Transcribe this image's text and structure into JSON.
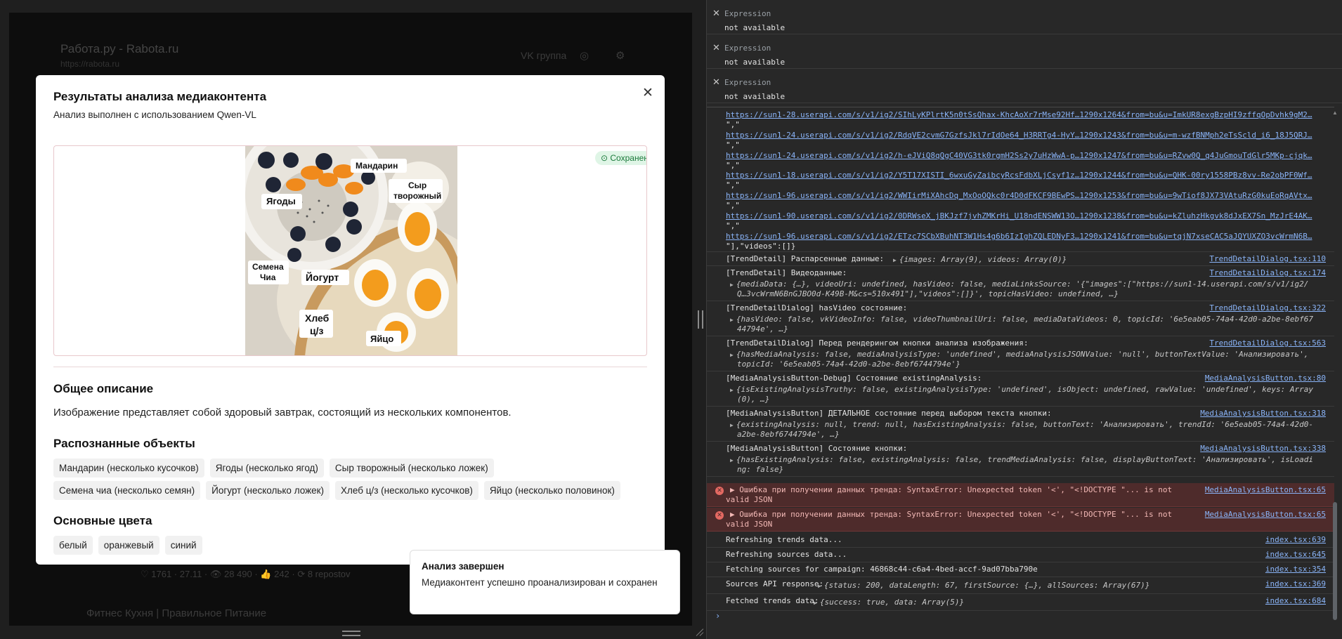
{
  "background": {
    "title": "Работа.ру - Rabota.ru",
    "subtitle": "https://rabota.ru",
    "vk_label": "VK группа",
    "stats": "♡ 1761 · 27.11 · 👁 28 490 · 👍 242 · ⟳ 8 repostov",
    "card_title": "Фитнес Кухня | Правильное Питание"
  },
  "modal": {
    "title": "Результаты анализа медиаконтента",
    "subtitle": "Анализ выполнен с использованием Qwen-VL",
    "saved_badge": "Сохранено",
    "image_labels": [
      "Мандарин",
      "Сыр творожный",
      "Ягоды",
      "Семена Чиа",
      "Йогурт",
      "Хлеб ц/з",
      "Яйцо"
    ],
    "description_title": "Общее описание",
    "description": "Изображение представляет собой здоровый завтрак, состоящий из нескольких компонентов.",
    "objects_title": "Распознанные объекты",
    "objects_row1": [
      "Мандарин (несколько кусочков)",
      "Ягоды (несколько ягод)",
      "Сыр творожный (несколько ложек)"
    ],
    "objects_row2": [
      "Семена чиа (несколько семян)",
      "Йогурт (несколько ложек)",
      "Хлеб ц/з (несколько кусочков)",
      "Яйцо (несколько половинок)"
    ],
    "colors_title": "Основные цвета",
    "colors": [
      "белый",
      "оранжевый",
      "синий"
    ]
  },
  "toast": {
    "title": "Анализ завершен",
    "body": "Медиаконтент успешно проанализирован и сохранен"
  },
  "devtools": {
    "watch": [
      {
        "label": "Expression",
        "value": "not available"
      },
      {
        "label": "Expression",
        "value": "not available"
      },
      {
        "label": "Expression",
        "value": "not available"
      }
    ],
    "url_lines": [
      "https://sun1-28.userapi.com/s/v1/ig2/SIhLyKPlrtK5n0tSsQhax-KhcAoXr7rMse92Hf…1290x1264&from=bu&u=ImkUR8exgBzpHI9zffqOpDvhk9gM2…",
      "https://sun1-24.userapi.com/s/v1/ig2/RdqVE2cvmG7GzfsJkl7rIdOe64_H3RRTg4-HyY…1290x1243&from=bu&u=m-wzfBNMph2eTsScld_i6_18J5QRJ…",
      "https://sun1-24.userapi.com/s/v1/ig2/h-eJViQ8qQgC40VG3tk0rgmH2Ss2y7uHzWwA-p…1290x1247&from=bu&u=RZvw0Q_q4JuGmouTdGlr5MKp-cjqk…",
      "https://sun1-18.userapi.com/s/v1/ig2/Y5T17XISTI_6wxuGyZaibcyRcsFdbXLjCsyf1z…1290x1244&from=bu&u=QHK-00ry1558PBz8vv-Re2obPF0Wf…",
      "https://sun1-96.userapi.com/s/v1/ig2/WWIirMiXAhcDq_MxOoOQkc0r4D0dFKCF9BEwPS…1290x1253&from=bu&u=9wTiof8JX73VAtuRzG0kuEoRqAVtx…",
      "https://sun1-90.userapi.com/s/v1/ig2/0DRWseX_jBKJzf7jvhZMKrHi_U18ndENSWW13O…1290x1238&from=bu&u=kZluhzHkgvk8dJxEX7Sn_MzJrE4AK…",
      "https://sun1-96.userapi.com/s/v1/ig2/ETzc7SCbXBuhNT3W1Hs4g6b6IzIghZQLEDNyF3…1290x1241&from=bu&u=tqjN7xseCAC5aJQYUXZO3vcWrmN6B…"
    ],
    "sep": "\",\"",
    "tail": "\"],\"videos\":[]}",
    "logs": [
      {
        "msg": "[TrendDetail] Распарсенные данные:",
        "src": "TrendDetailDialog.tsx:110",
        "obj": "{images: Array(9), videos: Array(0)}"
      },
      {
        "msg": "[TrendDetail] Видеоданные:",
        "src": "TrendDetailDialog.tsx:174",
        "obj1": "{mediaData: {…}, videoUri: undefined, hasVideo: false, mediaLinksSource: '{\"images\":[\"https://sun1-14.userapi.com/s/v1/ig2/",
        "obj2": "Q…3vcWrmN6BnGJBO0d-K49B-M&cs=510x491\"],\"videos\":[]}', topicHasVideo: undefined, …}"
      },
      {
        "msg": "[TrendDetailDialog] hasVideo состояние:",
        "src": "TrendDetailDialog.tsx:322",
        "obj1": "{hasVideo: false, vkVideoInfo: false, videoThumbnailUri: false, mediaDataVideos: 0, topicId: '6e5eab05-74a4-42d0-a2be-8ebf67",
        "obj2": "44794e', …}"
      },
      {
        "msg": "[TrendDetailDialog] Перед рендерингом кнопки анализа изображения:",
        "src": "TrendDetailDialog.tsx:563",
        "obj1": "{hasMediaAnalysis: false, mediaAnalysisType: 'undefined', mediaAnalysisJSONValue: 'null', buttonTextValue: 'Анализировать',",
        "obj2": "topicId: '6e5eab05-74a4-42d0-a2be-8ebf6744794e'}"
      },
      {
        "msg": "[MediaAnalysisButton-Debug] Состояние existingAnalysis:",
        "src": "MediaAnalysisButton.tsx:80",
        "obj1": "{isExistingAnalysisTruthy: false, existingAnalysisType: 'undefined', isObject: undefined, rawValue: 'undefined', keys: Array",
        "obj2": "(0), …}"
      },
      {
        "msg": "[MediaAnalysisButton] ДЕТАЛЬНОЕ состояние перед выбором текста кнопки:",
        "src": "MediaAnalysisButton.tsx:318",
        "obj1": "{existingAnalysis: null, trend: null, hasExistingAnalysis: false, buttonText: 'Анализировать', trendId: '6e5eab05-74a4-42d0-",
        "obj2": "a2be-8ebf6744794e', …}"
      },
      {
        "msg": "[MediaAnalysisButton] Состояние кнопки:",
        "src": "MediaAnalysisButton.tsx:338",
        "obj1": "{hasExistingAnalysis: false, existingAnalysis: false, trendMediaAnalysis: false, displayButtonText: 'Анализировать', isLoadi",
        "obj2": "ng: false}"
      }
    ],
    "errors": [
      {
        "msg1": "▶ Ошибка при получении данных тренда: SyntaxError: Unexpected token '<', \"<!DOCTYPE \"... is not",
        "msg2": "valid JSON",
        "src": "MediaAnalysisButton.tsx:65"
      },
      {
        "msg1": "▶ Ошибка при получении данных тренда: SyntaxError: Unexpected token '<', \"<!DOCTYPE \"... is not",
        "msg2": "valid JSON",
        "src": "MediaAnalysisButton.tsx:65"
      }
    ],
    "tail_logs": [
      {
        "msg": "Refreshing trends data...",
        "src": "index.tsx:639"
      },
      {
        "msg": "Refreshing sources data...",
        "src": "index.tsx:645"
      },
      {
        "msg": "Fetching sources for campaign: 46868c44-c6a4-4bed-accf-9ad07bba790e",
        "src": "index.tsx:354"
      },
      {
        "msg": "Sources API response:",
        "src": "index.tsx:369",
        "obj": "{status: 200, dataLength: 67, firstSource: {…}, allSources: Array(67)}"
      },
      {
        "msg": "Fetched trends data:",
        "src": "index.tsx:684",
        "obj": "{success: true, data: Array(5)}"
      }
    ],
    "prompt": "›"
  }
}
